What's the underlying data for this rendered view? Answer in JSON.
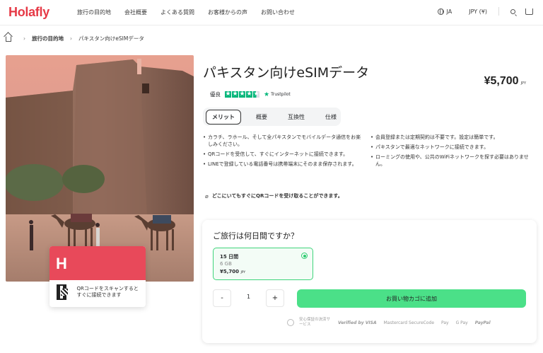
{
  "header": {
    "logo": "Holafly",
    "nav": [
      "旅行の目的地",
      "会社概要",
      "よくある質問",
      "お客様からの声",
      "お問い合わせ"
    ],
    "language": "JA",
    "currency": "JPY (¥)"
  },
  "breadcrumb": {
    "items": [
      "旅行の目的地",
      "パキスタン向けeSIMデータ"
    ]
  },
  "product": {
    "title": "パキスタン向けeSIMデータ",
    "price": "¥5,700",
    "price_currency": "JPY",
    "rating_label": "優良",
    "rating_stars": 4.5,
    "rating_source": "Trustpilot"
  },
  "tabs": [
    "メリット",
    "概要",
    "互換性",
    "仕様"
  ],
  "benefits_left": [
    "カラチ、ラホール、そして全パキスタンでモバイルデータ通信をお楽しみください。",
    "QRコードを受信して、すぐにインターネットに接続できます。",
    "LINEで登録している電話番号は携帯端末にそのまま保存されます。"
  ],
  "benefits_right": [
    "会員登録または定期契約は不要です。設定は簡単です。",
    "パキスタンで最適なネットワークに接続できます。",
    "ローミングの使用や、公共のWiFiネットワークを探す必要はありません。"
  ],
  "note": "どこにいてもすぐにQRコードを受け取ることができます。",
  "card": {
    "logo": "H",
    "text": "QRコードをスキャンするとすぐに接続できます"
  },
  "purchase": {
    "question": "ご旅行は何日間ですか？",
    "plan": {
      "days": "15 日間",
      "data": "6 GB",
      "price": "¥5,700",
      "currency": "JPY"
    },
    "quantity": "1",
    "minus": "-",
    "plus": "+",
    "add_to_cart": "お買い物カゴに追加",
    "secure_label": "安心保証の決済サービス",
    "payment_methods": [
      "Verified by VISA",
      "Mastercard SecureCode",
      "Pay",
      "G Pay",
      "PayPal"
    ]
  },
  "colors": {
    "brand": "#e63946",
    "cta": "#4be088",
    "trustpilot": "#00b67a"
  }
}
